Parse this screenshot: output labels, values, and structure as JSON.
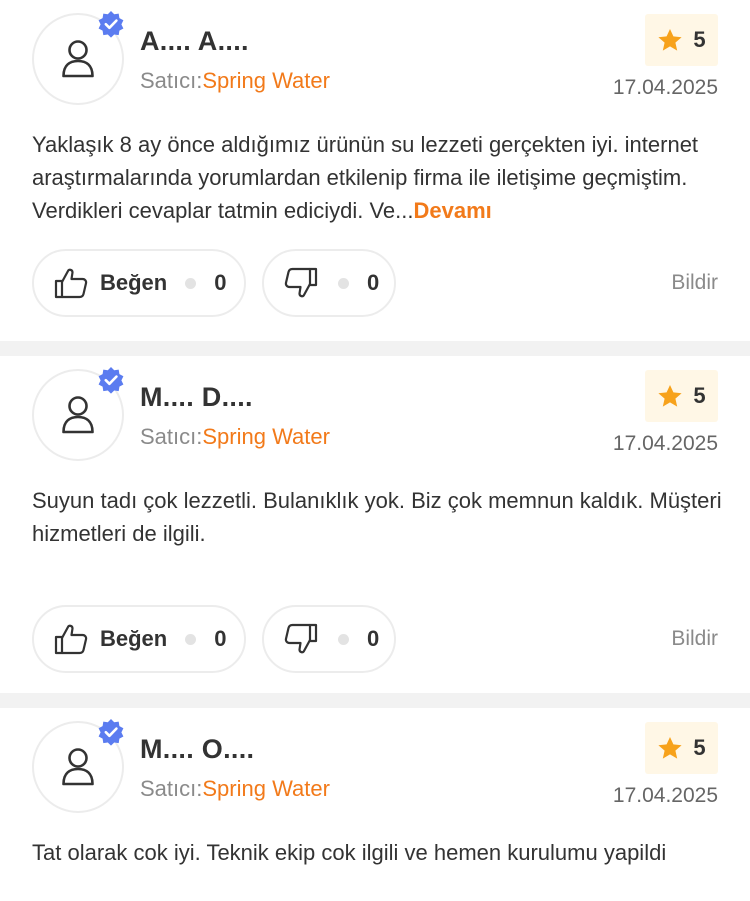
{
  "reviews": [
    {
      "author": "A.... A....",
      "seller_prefix": "Satıcı:",
      "seller_name": "Spring Water",
      "rating": "5",
      "date": "17.04.2025",
      "text": "Yaklaşık 8 ay önce aldığımız ürünün su lezzeti gerçekten iyi. internet araştırmalarında yorumlardan etkilenip firma ile iletişime geçmiştim. Verdikleri cevaplar tatmin ediciydi. Ve...",
      "more_label": "Devamı",
      "like_label": "Beğen",
      "like_count": "0",
      "dislike_count": "0",
      "report_label": "Bildir"
    },
    {
      "author": "M.... D....",
      "seller_prefix": "Satıcı:",
      "seller_name": "Spring Water",
      "rating": "5",
      "date": "17.04.2025",
      "text": "Suyun tadı çok lezzetli. Bulanıklık yok. Biz çok memnun kaldık. Müşteri hizmetleri de ilgili.",
      "like_label": "Beğen",
      "like_count": "0",
      "dislike_count": "0",
      "report_label": "Bildir"
    },
    {
      "author": "M.... O....",
      "seller_prefix": "Satıcı:",
      "seller_name": "Spring Water",
      "rating": "5",
      "date": "17.04.2025",
      "text": "Tat olarak cok iyi. Teknik ekip cok ilgili ve hemen kurulumu yapildi"
    }
  ],
  "colors": {
    "accent": "#f27a1a",
    "verified": "#5b7cf0",
    "star": "#f7a21b",
    "rating_bg": "#fff7e6",
    "divider": "#f2f2f2"
  },
  "icons": [
    "user-icon",
    "verified-badge-icon",
    "star-icon",
    "thumbs-up-icon",
    "thumbs-down-icon"
  ]
}
